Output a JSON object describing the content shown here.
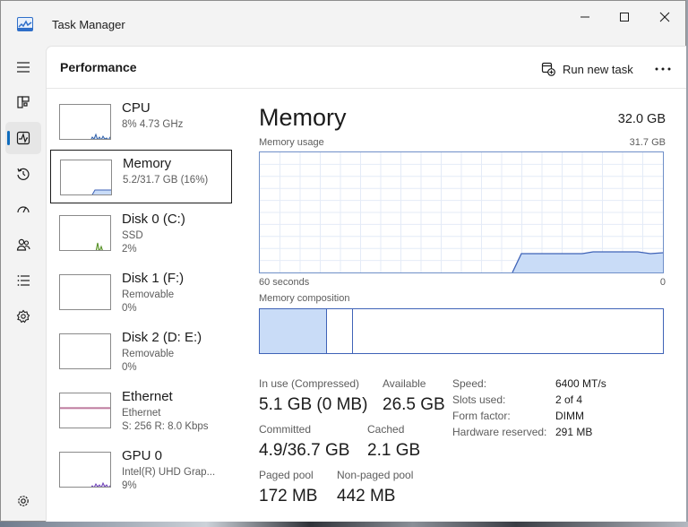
{
  "window": {
    "title": "Task Manager"
  },
  "header": {
    "title": "Performance",
    "run_task_label": "Run new task"
  },
  "nav": [
    {
      "name": "hamburger-icon",
      "active": false
    },
    {
      "name": "processes-icon",
      "active": false
    },
    {
      "name": "performance-icon",
      "active": true
    },
    {
      "name": "app-history-icon",
      "active": false
    },
    {
      "name": "startup-apps-icon",
      "active": false
    },
    {
      "name": "users-icon",
      "active": false
    },
    {
      "name": "details-icon",
      "active": false
    },
    {
      "name": "services-icon",
      "active": false
    },
    {
      "name": "settings-icon",
      "active": false
    }
  ],
  "devices": [
    {
      "name": "CPU",
      "line1": "8% 4.73 GHz",
      "line2": "",
      "graph_color": "#2f5fa8",
      "fill_color": "#c9dcf7"
    },
    {
      "name": "Memory",
      "line1": "5.2/31.7 GB (16%)",
      "line2": "",
      "graph_color": "#3f63b7",
      "fill_color": "#c9dcf7"
    },
    {
      "name": "Disk 0 (C:)",
      "line1": "SSD",
      "line2": "2%",
      "graph_color": "#4f8a1e",
      "fill_color": "#d6ecc0"
    },
    {
      "name": "Disk 1 (F:)",
      "line1": "Removable",
      "line2": "0%",
      "graph_color": "#4f8a1e",
      "fill_color": "#d6ecc0"
    },
    {
      "name": "Disk 2 (D: E:)",
      "line1": "Removable",
      "line2": "0%",
      "graph_color": "#4f8a1e",
      "fill_color": "#d6ecc0"
    },
    {
      "name": "Ethernet",
      "line1": "Ethernet",
      "line2": "S: 256 R: 8.0 Kbps",
      "graph_color": "#a34d7a",
      "fill_color": "#f1d9e6"
    },
    {
      "name": "GPU 0",
      "line1": "Intel(R) UHD Grap...",
      "line2": "9%",
      "graph_color": "#6c3fb7",
      "fill_color": "#e2d6f5"
    }
  ],
  "detail": {
    "title": "Memory",
    "total": "32.0 GB",
    "usage_label": "Memory usage",
    "usage_max": "31.7 GB",
    "time_left": "60 seconds",
    "time_right": "0",
    "composition_label": "Memory composition",
    "stats": {
      "in_use_label": "In use (Compressed)",
      "in_use_value": "5.1 GB (0 MB)",
      "available_label": "Available",
      "available_value": "26.5 GB",
      "committed_label": "Committed",
      "committed_value": "4.9/36.7 GB",
      "cached_label": "Cached",
      "cached_value": "2.1 GB",
      "paged_label": "Paged pool",
      "paged_value": "172 MB",
      "nonpaged_label": "Non-paged pool",
      "nonpaged_value": "442 MB"
    },
    "specs": [
      {
        "key": "Speed:",
        "value": "6400 MT/s"
      },
      {
        "key": "Slots used:",
        "value": "2 of 4"
      },
      {
        "key": "Form factor:",
        "value": "DIMM"
      },
      {
        "key": "Hardware reserved:",
        "value": "291 MB"
      }
    ]
  },
  "colors": {
    "accent": "#0f6cbd",
    "memory_line": "#3f63b7",
    "memory_fill": "#c9dcf7"
  }
}
